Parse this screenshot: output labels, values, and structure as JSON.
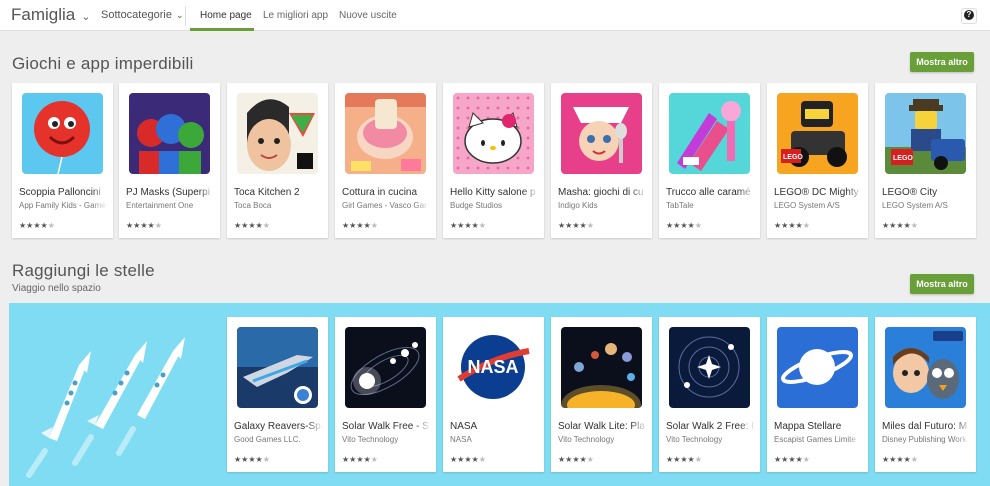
{
  "nav": {
    "category": "Famiglia",
    "subcategories": "Sottocategorie",
    "tabs": [
      "Home page",
      "Le migliori app",
      "Nuove uscite"
    ],
    "help": "?"
  },
  "section1": {
    "title": "Giochi e app imperdibili",
    "more": "Mostra altro",
    "apps": [
      {
        "name": "Scoppia Palloncini",
        "dev": "App Family Kids - Game",
        "stars": 4
      },
      {
        "name": "PJ Masks (Superpi",
        "dev": "Entertainment One",
        "stars": 4
      },
      {
        "name": "Toca Kitchen 2",
        "dev": "Toca Boca",
        "stars": 4
      },
      {
        "name": "Cottura in cucina",
        "dev": "Girl Games - Vasco Gar",
        "stars": 4
      },
      {
        "name": "Hello Kitty salone p",
        "dev": "Budge Studios",
        "stars": 4
      },
      {
        "name": "Masha: giochi di cu",
        "dev": "Indigo Kids",
        "stars": 4
      },
      {
        "name": "Trucco alle caramé",
        "dev": "TabTale",
        "stars": 4
      },
      {
        "name": "LEGO® DC Mighty",
        "dev": "LEGO System A/S",
        "stars": 4
      },
      {
        "name": "LEGO® City",
        "dev": "LEGO System A/S",
        "stars": 4
      }
    ]
  },
  "section2": {
    "title": "Raggiungi le stelle",
    "subtitle": "Viaggio nello spazio",
    "more": "Mostra altro",
    "apps": [
      {
        "name": "Galaxy Reavers-Spa",
        "dev": "Good Games LLC.",
        "stars": 4
      },
      {
        "name": "Solar Walk Free - S",
        "dev": "Vito Technology",
        "stars": 4
      },
      {
        "name": "NASA",
        "dev": "NASA",
        "stars": 4
      },
      {
        "name": "Solar Walk Lite: Pla",
        "dev": "Vito Technology",
        "stars": 4
      },
      {
        "name": "Solar Walk 2 Free: P",
        "dev": "Vito Technology",
        "stars": 4
      },
      {
        "name": "Mappa Stellare",
        "dev": "Escapist Games Limite",
        "stars": 4
      },
      {
        "name": "Miles dal Futuro: M",
        "dev": "Disney Publishing Work",
        "stars": 4
      }
    ]
  },
  "colors": {
    "accent": "#689f38",
    "banner": "#7fdcf2"
  }
}
